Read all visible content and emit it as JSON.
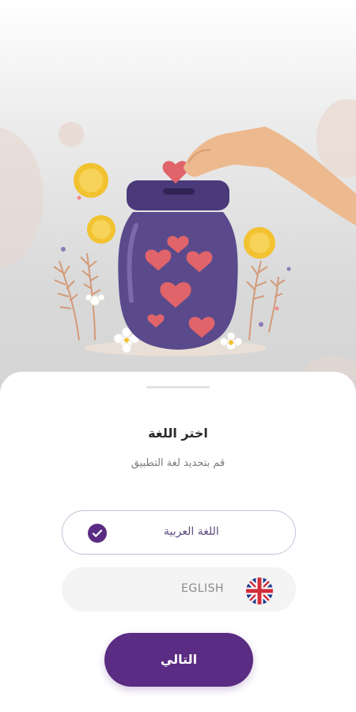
{
  "language_sheet": {
    "title": "اختر اللغة",
    "subtitle": "قم بتحديد لغة التطبيق",
    "options": [
      {
        "label": "اللغة العربية",
        "selected": true,
        "icon": "check-icon"
      },
      {
        "label": "EGLISH",
        "selected": false,
        "icon": "uk-flag-icon"
      }
    ],
    "next_label": "التالي"
  },
  "colors": {
    "primary": "#5b2c83",
    "jar": "#5a4a8c",
    "heart": "#e0646a",
    "coin": "#f2c230"
  }
}
